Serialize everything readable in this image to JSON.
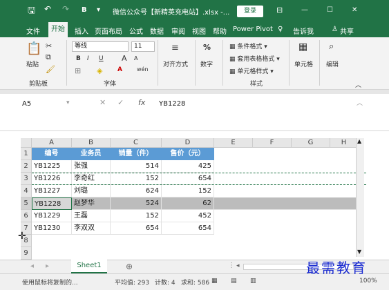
{
  "titlebar": {
    "save_icon": "save-icon",
    "undo_icon": "undo-icon",
    "redo_icon": "redo-icon",
    "bold_shortcut": "B",
    "qat_more": "▾",
    "document_title": "微信公众号【新精英充电站】.xlsx -...",
    "login_label": "登录",
    "ribbon_display_icon": "ribbon-display-icon",
    "minimize": "—",
    "maximize": "☐",
    "close": "✕"
  },
  "menu": {
    "items": [
      "文件",
      "开始",
      "插入",
      "页面布局",
      "公式",
      "数据",
      "审阅",
      "视图",
      "帮助",
      "Power Pivot"
    ],
    "active": "开始",
    "tell_me": "告诉我",
    "share": "共享"
  },
  "ribbon": {
    "clipboard": {
      "paste": "粘贴",
      "group": "剪贴板"
    },
    "font": {
      "name": "等线",
      "size": "11",
      "bold": "B",
      "italic": "I",
      "underline": "U",
      "grow": "A",
      "shrink": "A",
      "color_a": "A",
      "wen": "wén",
      "group": "字体"
    },
    "alignment": {
      "label": "对齐方式"
    },
    "number": {
      "label": "数字",
      "percent": "%"
    },
    "styles": {
      "cond_format": "条件格式",
      "table_format": "套用表格格式",
      "cell_styles": "单元格样式",
      "group": "样式"
    },
    "cells": {
      "label": "单元格"
    },
    "editing": {
      "label": "编辑"
    }
  },
  "formula_bar": {
    "name_box": "A5",
    "cancel": "✕",
    "confirm": "✓",
    "fx": "fx",
    "value": "YB1228"
  },
  "grid": {
    "columns": [
      "A",
      "B",
      "C",
      "D",
      "E",
      "F",
      "G",
      "H"
    ],
    "rows": [
      "1",
      "2",
      "3",
      "4",
      "5",
      "6",
      "7",
      "8",
      "9"
    ],
    "selected_row": "5",
    "header": [
      "编号",
      "业务员",
      "销量（件）",
      "售价（元）"
    ],
    "data": [
      [
        "YB1225",
        "张强",
        "514",
        "425"
      ],
      [
        "YB1226",
        "李奇红",
        "152",
        "654"
      ],
      [
        "YB1227",
        "刘璐",
        "624",
        "152"
      ],
      [
        "YB1228",
        "赵梦华",
        "524",
        "62"
      ],
      [
        "YB1229",
        "王磊",
        "152",
        "452"
      ],
      [
        "YB1230",
        "李双双",
        "654",
        "654"
      ]
    ]
  },
  "sheets": {
    "tabs": [
      "Sheet1"
    ],
    "add": "⊕"
  },
  "status": {
    "message": "使用鼠标将复制的...",
    "average": "平均值: 293",
    "count": "计数: 4",
    "sum": "求和: 586",
    "zoom": "100%"
  },
  "watermark": "最需教育"
}
